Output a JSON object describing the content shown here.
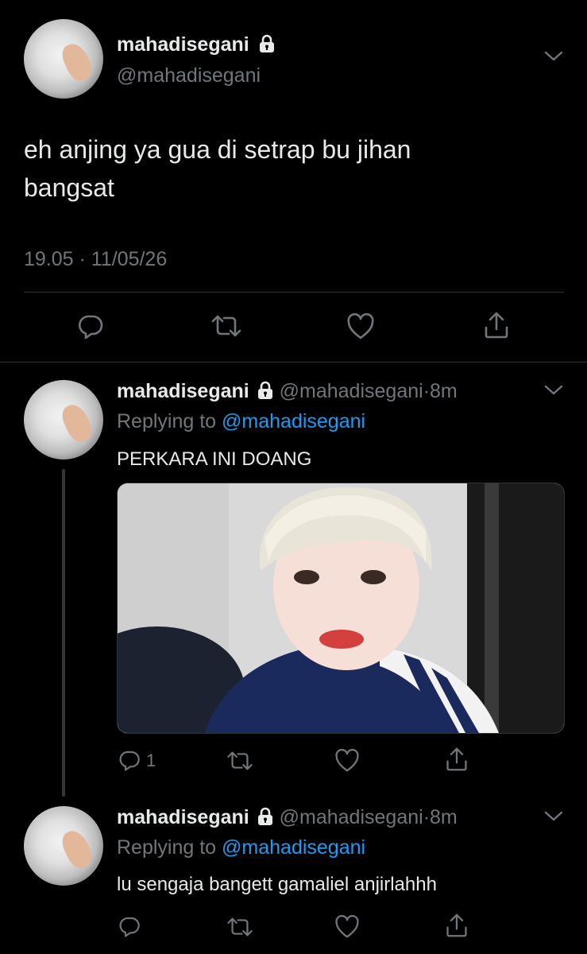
{
  "main_tweet": {
    "display_name": "mahadisegani",
    "handle": "@mahadisegani",
    "text_line1": "eh anjing ya gua di setrap bu jihan",
    "text_line2": "bangsat",
    "timestamp": "19.05 · 11/05/26"
  },
  "replies": [
    {
      "display_name": "mahadisegani",
      "handle": "@mahadisegani",
      "time": "8m",
      "replying_label": "Replying to",
      "replying_handle": "@mahadisegani",
      "text": "PERKARA INI DOANG",
      "reply_count": "1"
    },
    {
      "display_name": "mahadisegani",
      "handle": "@mahadisegani",
      "time": "8m",
      "replying_label": "Replying to",
      "replying_handle": "@mahadisegani",
      "text": "lu sengaja bangett gamaliel anjirlahhh"
    }
  ],
  "icons": [
    "lock-icon",
    "chevron-down-icon",
    "reply-icon",
    "retweet-icon",
    "like-icon",
    "share-icon"
  ],
  "colors": {
    "background": "#000000",
    "text": "#e7e9ea",
    "muted": "#71767b",
    "link": "#1d9bf0",
    "divider": "#2f3336"
  }
}
